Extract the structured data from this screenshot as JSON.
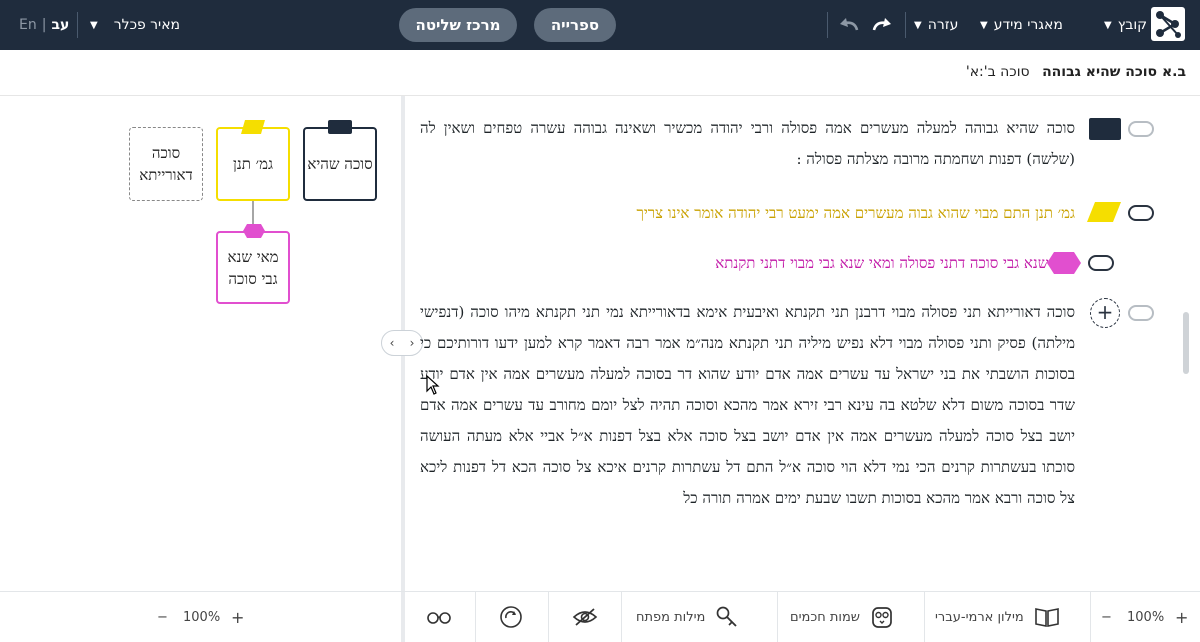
{
  "topbar": {
    "menu": {
      "file": "קובץ",
      "sources": "מאגרי מידע",
      "help": "עזרה"
    },
    "pills": {
      "library": "ספרייה",
      "control": "מרכז שליטה"
    },
    "user": "מאיר פכלר",
    "lang_active": "עב",
    "lang_sep": "|",
    "lang_other": "En"
  },
  "breadcrumb": {
    "title": "ב.א סוכה שהיא גבוהה",
    "sub": "סוכה ב':א'"
  },
  "text": {
    "p1": "סוכה שהיא גבוהה למעלה מעשרים אמה פסולה ורבי יהודה מכשיר ושאינה גבוהה עשרה טפחים ושאין לה (שלשה) דפנות ושחמתה מרובה מצלתה פסולה :",
    "p2": "גמ׳ תנן התם מבוי שהוא גבוה מעשרים אמה ימעט רבי יהודה אומר אינו צריך",
    "p3": "מאי שנא גבי סוכה דתני פסולה ומאי שנא גבי מבוי דתני תקנתא",
    "p4": "סוכה דאורייתא תני פסולה מבוי דרבנן תני תקנתא ואיבעית אימא בדאורייתא נמי תני תקנתא מיהו סוכה (דנפישי מילתה) פסיק ותני פסולה מבוי דלא נפיש מיליה תני תקנתא מנה״מ אמר רבה דאמר קרא למען ידעו דורותיכם כי בסוכות הושבתי את בני ישראל עד עשרים אמה אדם יודע שהוא דר בסוכה למעלה מעשרים אמה אין אדם יודע שדר בסוכה משום דלא שלטא בה עינא רבי זירא אמר מהכא וסוכה תהיה לצל יומם מחורב עד עשרים אמה אדם יושב בצל סוכה למעלה מעשרים אמה אין אדם יושב בצל סוכה אלא בצל דפנות א״ל אביי אלא מעתה העושה סוכתו בעשתרות קרנים הכי נמי דלא הוי סוכה א״ל התם דל עשתרות קרנים איכא צל סוכה הכא דל דפנות ליכא צל סוכה ורבא אמר מהכא בסוכות תשבו שבעת ימים אמרה תורה כל"
  },
  "diagram": {
    "nodes": {
      "sukkah": "סוכה שהיא",
      "gemara": "גמ׳ תנן",
      "deoraita": "סוכה דאורייתא",
      "mai": "מאי שנא גבי סוכה"
    },
    "colors": {
      "navy": "#1f2c3d",
      "yellow": "#f5de00",
      "pink": "#e14fcf",
      "gray": "#888888"
    }
  },
  "bottom": {
    "zoom_left": "100%",
    "zoom_right": "100%",
    "minus": "−",
    "plus": "+",
    "dict": "מילון ארמי-עברי",
    "sages": "שמות חכמים",
    "keywords": "מילות מפתח",
    "icons": [
      "book-icon",
      "owl-icon",
      "key-icon",
      "eye-off-icon",
      "refresh-icon",
      "glasses-icon"
    ]
  }
}
